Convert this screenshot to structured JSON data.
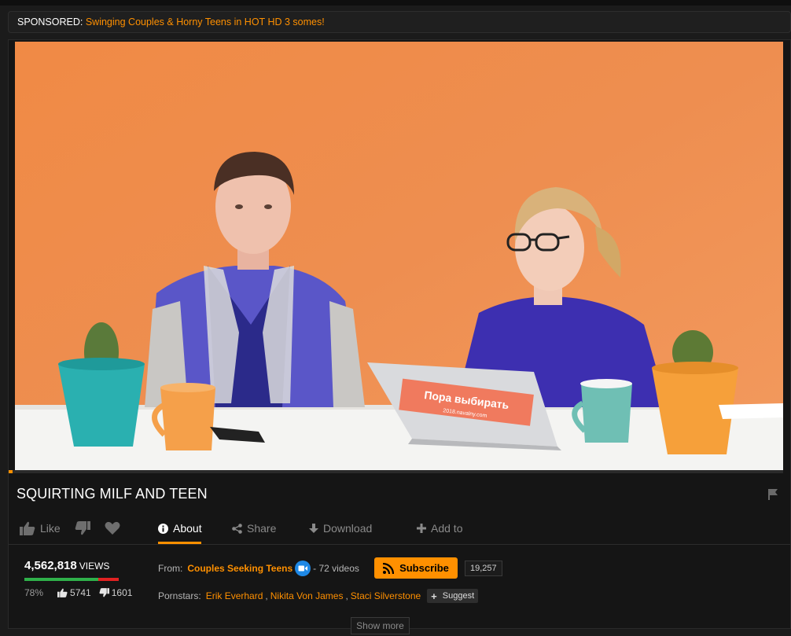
{
  "sponsored": {
    "label": "SPONSORED:",
    "link_text": "Swinging Couples & Horny Teens in HOT HD 3 somes!"
  },
  "player": {
    "progress_fraction": 0.005,
    "laptop_sticker_line1": "Пора выбирать",
    "laptop_sticker_line2": "2018.navalny.com"
  },
  "video": {
    "title": "SQUIRTING MILF AND TEEN"
  },
  "actions": {
    "like_label": "Like",
    "tabs": [
      {
        "label": "About",
        "icon": "info-icon",
        "active": true
      },
      {
        "label": "Share",
        "icon": "share-icon",
        "active": false
      },
      {
        "label": "Download",
        "icon": "download-icon",
        "active": false
      },
      {
        "label": "Add to",
        "icon": "plus-icon",
        "active": false
      }
    ]
  },
  "stats": {
    "views": "4,562,818",
    "views_label": "VIEWS",
    "rating_percent": "78%",
    "rating_fraction": 0.78,
    "likes": "5741",
    "dislikes": "1601"
  },
  "from": {
    "label": "From:",
    "channel": "Couples Seeking Teens",
    "video_count": "- 72 videos"
  },
  "subscribe": {
    "label": "Subscribe",
    "count": "19,257"
  },
  "pornstars": {
    "label": "Pornstars:",
    "names": [
      "Erik Everhard",
      "Nikita Von James",
      "Staci Silverstone"
    ],
    "suggest_label": "Suggest"
  },
  "show_more": "Show more",
  "colors": {
    "accent": "#ff9000",
    "background": "#1b1b1b",
    "like_green": "#2fb14a",
    "dislike_red": "#e22222",
    "verified_blue": "#1e88e5"
  }
}
